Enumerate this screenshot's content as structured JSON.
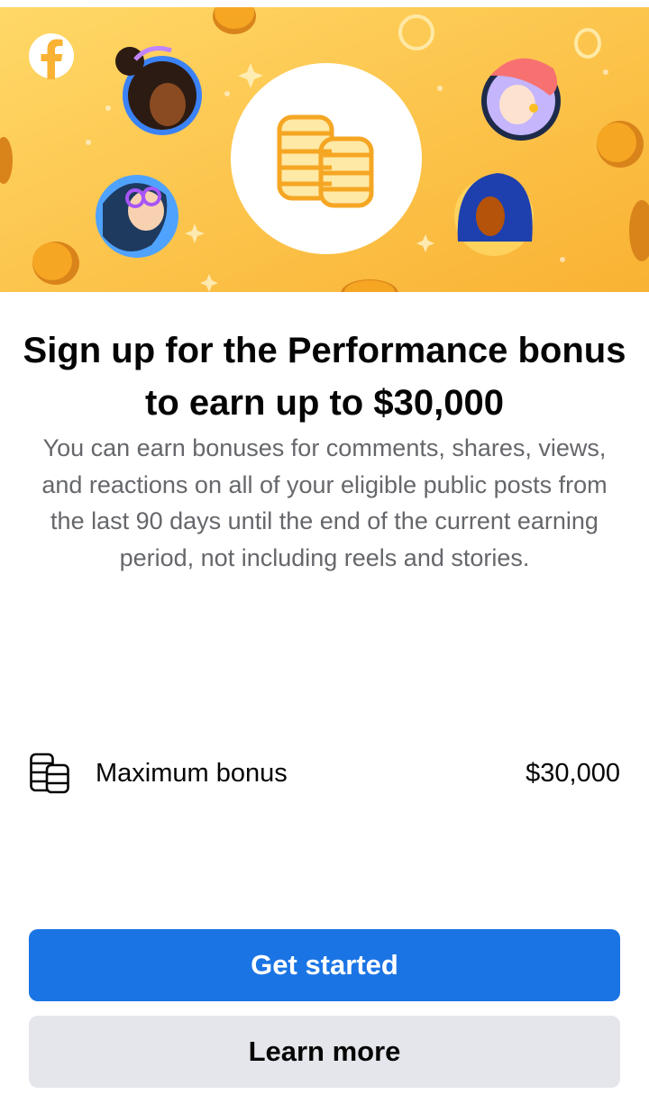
{
  "hero": {
    "illustration": "performance-bonus-coins-illustration",
    "colors": {
      "background_light": "#ffd25e",
      "background_dark": "#f9b233",
      "coin": "#f5a623",
      "coin_shadow": "#d9841a",
      "circle": "#ffffff",
      "facebook_logo": "#ffffff"
    }
  },
  "headline": "Sign up for the Performance bonus to earn up to $30,000",
  "description": "You can earn bonuses for comments, shares, views, and reactions on all of your eligible public posts from the last 90 days until the end of the current earning period, not including reels and stories.",
  "bonus": {
    "icon": "coin-stack-icon",
    "label": "Maximum bonus",
    "value": "$30,000"
  },
  "buttons": {
    "primary_label": "Get started",
    "secondary_label": "Learn more"
  },
  "colors": {
    "primary": "#1b74e4",
    "secondary": "#e4e6eb",
    "text": "#050505",
    "muted_text": "#65676b"
  }
}
